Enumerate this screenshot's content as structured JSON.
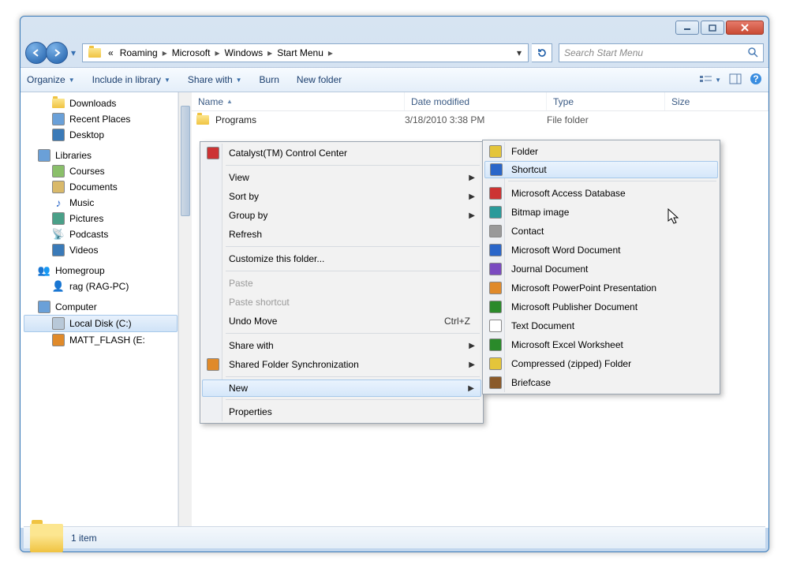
{
  "window": {
    "controls": {
      "min": "minimize",
      "max": "maximize",
      "close": "close"
    }
  },
  "address": {
    "overflow": "«",
    "crumbs": [
      "Roaming",
      "Microsoft",
      "Windows",
      "Start Menu"
    ]
  },
  "search": {
    "placeholder": "Search Start Menu"
  },
  "toolbar": {
    "organize": "Organize",
    "include": "Include in library",
    "share": "Share with",
    "burn": "Burn",
    "newfolder": "New folder"
  },
  "sidebar": {
    "fav": [
      {
        "label": "Downloads",
        "icon": "folder"
      },
      {
        "label": "Recent Places",
        "icon": "recent"
      },
      {
        "label": "Desktop",
        "icon": "desktop"
      }
    ],
    "libraries_label": "Libraries",
    "libraries": [
      {
        "label": "Courses",
        "icon": "generic"
      },
      {
        "label": "Documents",
        "icon": "doc"
      },
      {
        "label": "Music",
        "icon": "music"
      },
      {
        "label": "Pictures",
        "icon": "pic"
      },
      {
        "label": "Podcasts",
        "icon": "podcast"
      },
      {
        "label": "Videos",
        "icon": "video"
      }
    ],
    "homegroup_label": "Homegroup",
    "homegroup_user": "rag (RAG-PC)",
    "computer_label": "Computer",
    "drives": [
      {
        "label": "Local Disk (C:)",
        "selected": true
      },
      {
        "label": "MATT_FLASH (E:"
      }
    ]
  },
  "columns": {
    "name": "Name",
    "date": "Date modified",
    "type": "Type",
    "size": "Size"
  },
  "rows": [
    {
      "name": "Programs",
      "date": "3/18/2010 3:38 PM",
      "type": "File folder"
    }
  ],
  "context_main": {
    "items": [
      {
        "label": "Catalyst(TM) Control Center",
        "icon": "ati"
      },
      {
        "sep": true
      },
      {
        "label": "View",
        "sub": true
      },
      {
        "label": "Sort by",
        "sub": true
      },
      {
        "label": "Group by",
        "sub": true
      },
      {
        "label": "Refresh"
      },
      {
        "sep": true
      },
      {
        "label": "Customize this folder..."
      },
      {
        "sep": true
      },
      {
        "label": "Paste",
        "disabled": true
      },
      {
        "label": "Paste shortcut",
        "disabled": true
      },
      {
        "label": "Undo Move",
        "shortcut": "Ctrl+Z"
      },
      {
        "sep": true
      },
      {
        "label": "Share with",
        "sub": true
      },
      {
        "label": "Shared Folder Synchronization",
        "sub": true,
        "icon": "sfs"
      },
      {
        "sep": true
      },
      {
        "label": "New",
        "sub": true,
        "hover": true
      },
      {
        "sep": true
      },
      {
        "label": "Properties"
      }
    ]
  },
  "context_new": {
    "items": [
      {
        "label": "Folder",
        "icon": "folder"
      },
      {
        "label": "Shortcut",
        "icon": "shortcut",
        "hover": true
      },
      {
        "sep": true
      },
      {
        "label": "Microsoft Access Database",
        "icon": "access"
      },
      {
        "label": "Bitmap image",
        "icon": "bitmap"
      },
      {
        "label": "Contact",
        "icon": "contact"
      },
      {
        "label": "Microsoft Word Document",
        "icon": "word"
      },
      {
        "label": "Journal Document",
        "icon": "journal"
      },
      {
        "label": "Microsoft PowerPoint Presentation",
        "icon": "ppt"
      },
      {
        "label": "Microsoft Publisher Document",
        "icon": "pub"
      },
      {
        "label": "Text Document",
        "icon": "txt"
      },
      {
        "label": "Microsoft Excel Worksheet",
        "icon": "xls"
      },
      {
        "label": "Compressed (zipped) Folder",
        "icon": "zip"
      },
      {
        "label": "Briefcase",
        "icon": "briefcase"
      }
    ]
  },
  "status": {
    "count": "1 item"
  }
}
